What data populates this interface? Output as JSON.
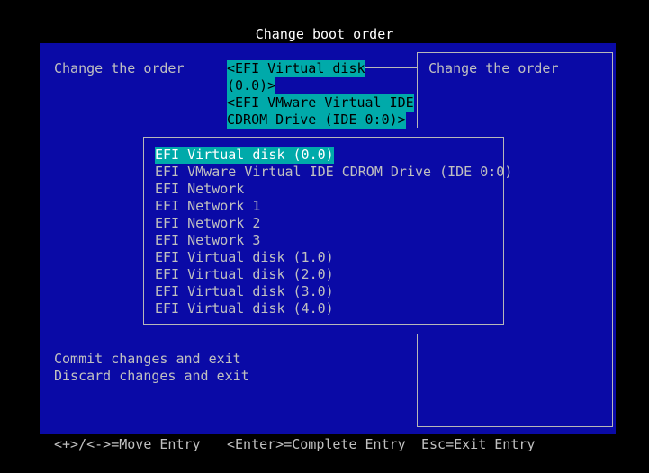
{
  "title": "Change boot order",
  "left_panel": {
    "label": "Change the order",
    "current_order_lines": [
      "<EFI Virtual disk",
      "(0.0)>",
      "<EFI VMware Virtual IDE",
      "CDROM Drive (IDE 0:0)>"
    ],
    "commit": "Commit changes and exit",
    "discard": "Discard changes and exit"
  },
  "help_panel": {
    "text": "Change the order"
  },
  "popup": {
    "items": [
      "EFI Virtual disk (0.0)",
      "EFI VMware Virtual IDE CDROM Drive (IDE 0:0)",
      "EFI Network",
      "EFI Network 1",
      "EFI Network 2",
      "EFI Network 3",
      "EFI Virtual disk (1.0)",
      "EFI Virtual disk (2.0)",
      "EFI Virtual disk (3.0)",
      "EFI Virtual disk (4.0)"
    ],
    "selected_index": 0
  },
  "footer": {
    "move": "<+>/<->=Move Entry",
    "complete": "<Enter>=Complete Entry",
    "exit": "Esc=Exit Entry"
  },
  "colors": {
    "background": "#000000",
    "panel": "#0a0aa6",
    "highlight": "#00aaaa",
    "text": "#c0c0c0"
  }
}
